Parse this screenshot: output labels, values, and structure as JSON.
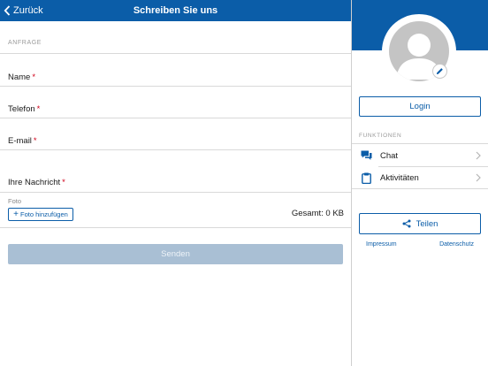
{
  "header": {
    "back_label": "Zurück",
    "title": "Schreiben Sie uns"
  },
  "form": {
    "section_label": "ANFRAGE",
    "fields": [
      {
        "label": "Name",
        "required_mark": "*"
      },
      {
        "label": "Telefon",
        "required_mark": "*"
      },
      {
        "label": "E-mail",
        "required_mark": "*"
      },
      {
        "label": "Ihre Nachricht",
        "required_mark": "*"
      }
    ],
    "foto_label": "Foto",
    "foto_button": "Foto hinzufügen",
    "total": "Gesamt: 0 KB",
    "send_button": "Senden"
  },
  "sidebar": {
    "login_button": "Login",
    "functions_label": "FUNKTIONEN",
    "menu": [
      {
        "label": "Chat",
        "icon": "chat-icon"
      },
      {
        "label": "Aktivitäten",
        "icon": "clipboard-icon"
      }
    ],
    "share_button": "Teilen",
    "links": {
      "impressum": "Impressum",
      "datenschutz": "Datenschutz"
    }
  },
  "colors": {
    "brand": "#0b5da8",
    "disabled_button": "#a9bfd4",
    "required": "#d0021b"
  }
}
